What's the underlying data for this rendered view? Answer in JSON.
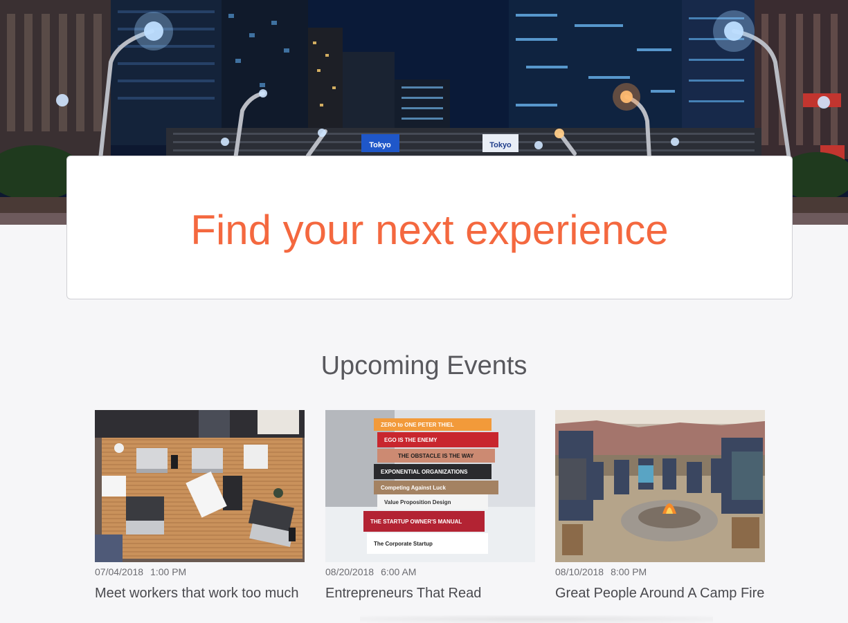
{
  "hero": {
    "sign_left": "Tokyo",
    "sign_right": "Tokyo",
    "headline": "Find your next experience"
  },
  "events_section": {
    "title": "Upcoming Events",
    "events": [
      {
        "date": "07/04/2018",
        "time": "1:00 PM",
        "title": "Meet workers that work too much"
      },
      {
        "date": "08/20/2018",
        "time": "6:00 AM",
        "title": "Entrepreneurs That Read"
      },
      {
        "date": "08/10/2018",
        "time": "8:00 PM",
        "title": "Great People Around A Camp Fire"
      }
    ]
  },
  "books": [
    "ZERO to ONE  PETER THIEL",
    "EGO IS THE ENEMY",
    "THE OBSTACLE IS THE WAY",
    "EXPONENTIAL ORGANIZATIONS",
    "Competing Against Luck",
    "Value Proposition Design",
    "THE STARTUP OWNER'S MANUAL",
    "The Corporate Startup"
  ],
  "colors": {
    "accent": "#f4683f",
    "heading": "#58585d",
    "text": "#49494e",
    "background": "#f6f6f8"
  }
}
